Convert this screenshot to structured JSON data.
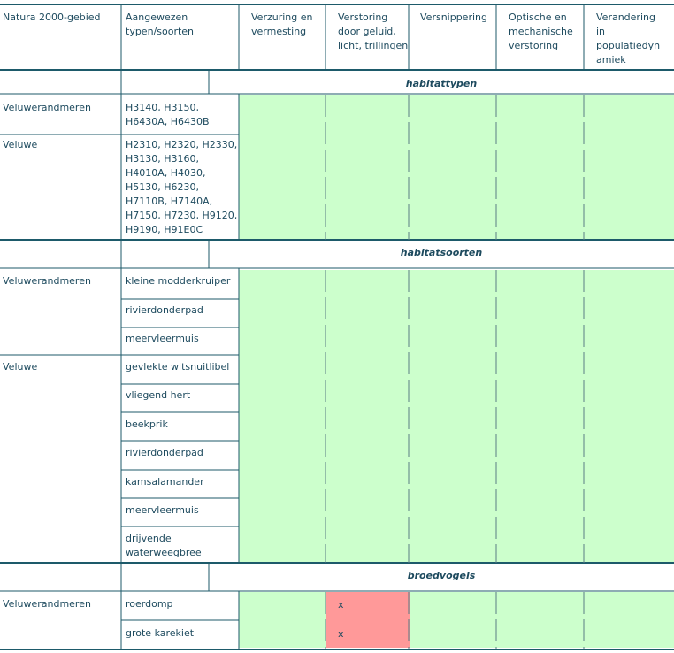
{
  "colors": {
    "ok": "#ccffcc",
    "impact": "#ff9999",
    "rule": "#1d5a6a",
    "text": "#1d4a5e"
  },
  "headers": {
    "gebied": "Natura 2000-gebied",
    "typen": "Aangewezen\ntypen/soorten",
    "verzuring": "Verzuring en\nvermesting",
    "verstoring": "Verstoring\ndoor geluid,\nlicht, trillingen",
    "versnippering": "Versnippering",
    "optische": "Optische en\nmechanische\nverstoring",
    "verandering": "Verandering\nin\npopulatiedyn\namiek"
  },
  "sections": {
    "habitattypen": "habitattypen",
    "habitatsoorten": "habitatsoorten",
    "broedvogels": "broedvogels"
  },
  "habitattypen": [
    {
      "gebied": "Veluwerandmeren",
      "typen": "H3140, H3150,\nH6430A, H6430B"
    },
    {
      "gebied": "Veluwe",
      "typen": "H2310, H2320, H2330,\nH3130, H3160,\nH4010A, H4030,\nH5130, H6230,\nH7110B, H7140A,\nH7150, H7230, H9120,\nH9190, H91E0C"
    }
  ],
  "habitatsoorten": [
    {
      "gebied": "Veluwerandmeren",
      "soorten": [
        "kleine modderkruiper",
        "rivierdonderpad",
        "meervleermuis"
      ]
    },
    {
      "gebied": "Veluwe",
      "soorten": [
        "gevlekte witsnuitlibel",
        "vliegend hert",
        "beekprik",
        "rivierdonderpad",
        "kamsalamander",
        "meervleermuis",
        "drijvende\nwaterweegbree"
      ]
    }
  ],
  "broedvogels": [
    {
      "gebied": "Veluwerandmeren",
      "soorten": [
        "roerdomp",
        "grote karekiet"
      ],
      "verstoring_marks": [
        "x",
        "x"
      ]
    }
  ]
}
